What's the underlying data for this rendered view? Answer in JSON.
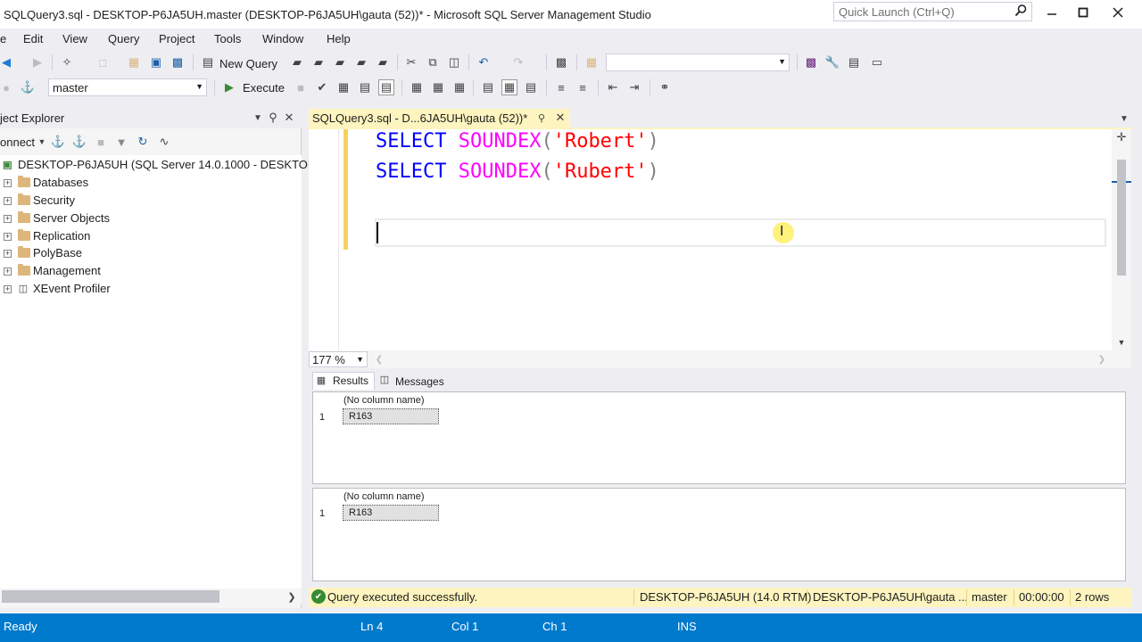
{
  "window": {
    "title": "SQLQuery3.sql - DESKTOP-P6JA5UH.master (DESKTOP-P6JA5UH\\gauta (52))* - Microsoft SQL Server Management Studio",
    "quick_launch_placeholder": "Quick Launch (Ctrl+Q)"
  },
  "menu": {
    "file": "e",
    "edit": "Edit",
    "view": "View",
    "query": "Query",
    "project": "Project",
    "tools": "Tools",
    "window": "Window",
    "help": "Help"
  },
  "toolbar": {
    "new_query": "New Query",
    "database": "master",
    "execute": "Execute"
  },
  "object_explorer": {
    "title": "ject Explorer",
    "connect": "onnect",
    "server": "DESKTOP-P6JA5UH (SQL Server 14.0.1000 - DESKTOP",
    "items": [
      {
        "label": "Databases"
      },
      {
        "label": "Security"
      },
      {
        "label": "Server Objects"
      },
      {
        "label": "Replication"
      },
      {
        "label": "PolyBase"
      },
      {
        "label": "Management"
      },
      {
        "label": "XEvent Profiler"
      }
    ]
  },
  "document_tab": {
    "label": "SQLQuery3.sql - D...6JA5UH\\gauta (52))*"
  },
  "editor": {
    "line1": {
      "kw": "SELECT",
      "fn": "SOUNDEX",
      "open": "(",
      "str": "'Robert'",
      "close": ")"
    },
    "line2": {
      "kw": "SELECT",
      "fn": "SOUNDEX",
      "open": "(",
      "str": "'Rubert'",
      "close": ")"
    },
    "zoom": "177 %"
  },
  "results": {
    "tabs": {
      "results": "Results",
      "messages": "Messages"
    },
    "grids": [
      {
        "column": "(No column name)",
        "row_number": "1",
        "value": "R163"
      },
      {
        "column": "(No column name)",
        "row_number": "1",
        "value": "R163"
      }
    ]
  },
  "query_status": {
    "message": "Query executed successfully.",
    "server": "DESKTOP-P6JA5UH (14.0 RTM)",
    "user": "DESKTOP-P6JA5UH\\gauta ...",
    "database": "master",
    "elapsed": "00:00:00",
    "rows": "2 rows"
  },
  "status_bar": {
    "state": "Ready",
    "line": "Ln 4",
    "col": "Col 1",
    "ch": "Ch 1",
    "mode": "INS"
  },
  "colors": {
    "accent": "#007acc",
    "tab_yellow": "#fdf4bf",
    "keyword": "#0000ff",
    "function": "#ff00ff",
    "string": "#ff0000"
  }
}
